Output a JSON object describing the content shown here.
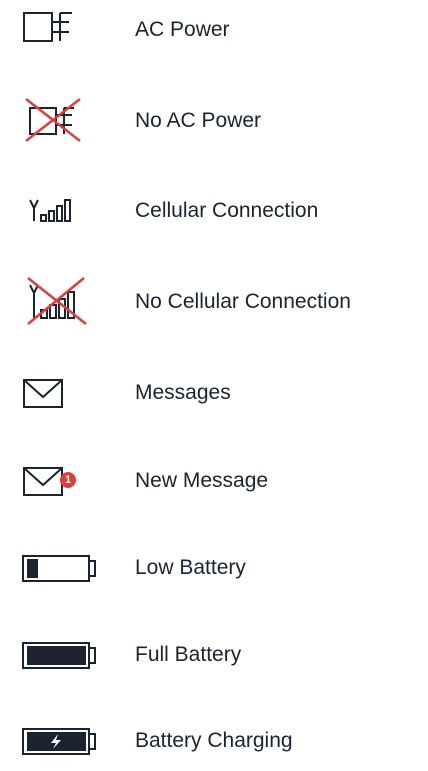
{
  "legend": {
    "items": [
      {
        "label": "AC Power",
        "icon": "ac-power-icon"
      },
      {
        "label": "No AC Power",
        "icon": "no-ac-power-icon"
      },
      {
        "label": "Cellular Connection",
        "icon": "cellular-signal-icon"
      },
      {
        "label": "No Cellular Connection",
        "icon": "no-cellular-signal-icon"
      },
      {
        "label": "Messages",
        "icon": "envelope-icon"
      },
      {
        "label": "New Message",
        "icon": "envelope-new-message-icon",
        "badge": "1"
      },
      {
        "label": "Low Battery",
        "icon": "battery-low-icon",
        "fill_fraction": 0.2
      },
      {
        "label": "Full Battery",
        "icon": "battery-full-icon",
        "fill_fraction": 1.0
      },
      {
        "label": "Battery Charging",
        "icon": "battery-charging-icon",
        "fill_fraction": 1.0
      }
    ]
  },
  "colors": {
    "icon_stroke": "#1b2331",
    "text": "#1b2331",
    "cross_out": "#e23b3b",
    "badge": "#e23b3b"
  }
}
